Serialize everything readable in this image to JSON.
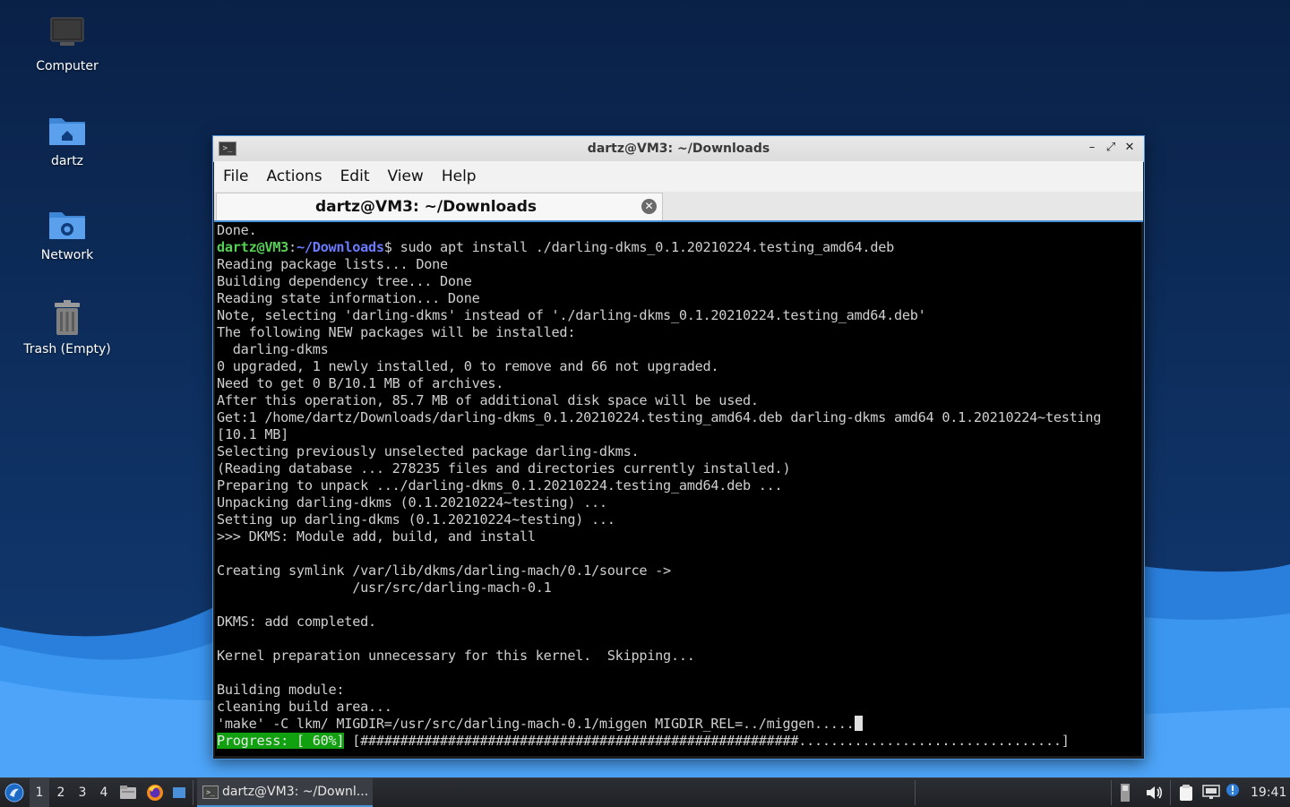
{
  "desktop": {
    "icons": [
      {
        "label": "Computer",
        "icon": "computer-icon"
      },
      {
        "label": "dartz",
        "icon": "home-folder-icon"
      },
      {
        "label": "Network",
        "icon": "network-folder-icon"
      },
      {
        "label": "Trash (Empty)",
        "icon": "trash-icon"
      }
    ]
  },
  "window": {
    "title": "dartz@VM3: ~/Downloads",
    "menu": [
      "File",
      "Actions",
      "Edit",
      "View",
      "Help"
    ],
    "tab_label": "dartz@VM3: ~/Downloads",
    "controls": [
      "minimize-icon",
      "maximize-icon",
      "close-icon"
    ]
  },
  "terminal": {
    "prompt_user": "dartz@VM3",
    "prompt_path": "~/Downloads",
    "prompt_suffix": "$ ",
    "command": "sudo apt install ./darling-dkms_0.1.20210224.testing_amd64.deb",
    "first_line": "Done.",
    "lines": [
      "Reading package lists... Done",
      "Building dependency tree... Done",
      "Reading state information... Done",
      "Note, selecting 'darling-dkms' instead of './darling-dkms_0.1.20210224.testing_amd64.deb'",
      "The following NEW packages will be installed:",
      "  darling-dkms",
      "0 upgraded, 1 newly installed, 0 to remove and 66 not upgraded.",
      "Need to get 0 B/10.1 MB of archives.",
      "After this operation, 85.7 MB of additional disk space will be used.",
      "Get:1 /home/dartz/Downloads/darling-dkms_0.1.20210224.testing_amd64.deb darling-dkms amd64 0.1.20210224~testing",
      "[10.1 MB]",
      "Selecting previously unselected package darling-dkms.",
      "(Reading database ... 278235 files and directories currently installed.)",
      "Preparing to unpack .../darling-dkms_0.1.20210224.testing_amd64.deb ...",
      "Unpacking darling-dkms (0.1.20210224~testing) ...",
      "Setting up darling-dkms (0.1.20210224~testing) ...",
      ">>> DKMS: Module add, build, and install",
      "",
      "Creating symlink /var/lib/dkms/darling-mach/0.1/source ->",
      "                 /usr/src/darling-mach-0.1",
      "",
      "DKMS: add completed.",
      "",
      "Kernel preparation unnecessary for this kernel.  Skipping...",
      "",
      "Building module:",
      "cleaning build area...",
      "'make' -C lkm/ MIGDIR=/usr/src/darling-mach-0.1/miggen MIGDIR_REL=../miggen....."
    ],
    "progress_label": "Progress: [ 60%]",
    "progress_percent": 60,
    "progress_bar": " [#######################################################.................................]"
  },
  "taskbar": {
    "workspaces": [
      "1",
      "2",
      "3",
      "4"
    ],
    "active_workspace": "1",
    "task_label": "dartz@VM3: ~/Downl...",
    "clock": "19:41",
    "launchers": [
      "file-manager-icon",
      "firefox-icon",
      "desktop-icon"
    ],
    "tray": [
      "keyboard-layout-icon",
      "volume-icon",
      "clipboard-icon",
      "network-icon",
      "update-notifier-icon"
    ]
  },
  "colors": {
    "accent": "#4a90d9",
    "prompt_user": "#55d155",
    "prompt_path": "#6b7bff",
    "progress_bg": "#10a010"
  }
}
